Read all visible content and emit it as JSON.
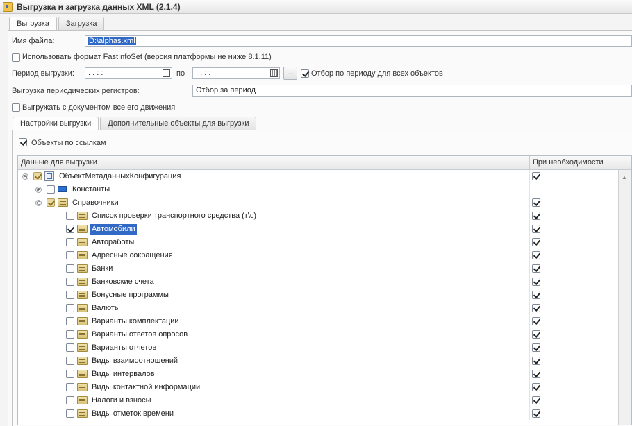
{
  "window": {
    "title": "Выгрузка и загрузка данных XML (2.1.4)"
  },
  "tabs": [
    {
      "label": "Выгрузка",
      "active": true
    },
    {
      "label": "Загрузка",
      "active": false
    }
  ],
  "form": {
    "file_label": "Имя файла:",
    "file_value": "D:\\alphas.xml",
    "fastinfoset_label": "Использовать формат FastInfoSet (версия платформы не ниже 8.1.11)",
    "fastinfoset_checked": false,
    "period_label": "Период выгрузки:",
    "period_from": " .  .     :  :",
    "period_to_label": "по",
    "period_to": " .  .     :  :",
    "period_button": "...",
    "filter_label": "Отбор по периоду для всех объектов",
    "filter_checked": true,
    "registers_label": "Выгрузка периодических регистров:",
    "registers_value": "Отбор за период",
    "movements_label": "Выгружать с документом все его движения",
    "movements_checked": false
  },
  "inner_tabs": [
    {
      "label": "Настройки выгрузки",
      "active": true
    },
    {
      "label": "Дополнительные объекты для выгрузки",
      "active": false
    }
  ],
  "refs_label": "Объекты по ссылкам",
  "grid": {
    "col_data": "Данные для выгрузки",
    "col_needed": "При необходимости",
    "rows": [
      {
        "label": "ОбъектМетаданныхКонфигурация",
        "level": 0,
        "expander": "⊖",
        "icon": "metadata-icon",
        "check": "partial",
        "needed": true
      },
      {
        "label": "Константы",
        "level": 1,
        "expander": "⊕",
        "icon": "constant-icon",
        "check": "off",
        "needed": false
      },
      {
        "label": "Справочники",
        "level": 1,
        "expander": "⊖",
        "icon": "folder-icon",
        "check": "partial",
        "needed": true
      },
      {
        "label": "Список проверки транспортного средства (т\\с)",
        "level": 2,
        "icon": "folder-icon",
        "check": "off",
        "needed": true
      },
      {
        "label": "Автомобили",
        "level": 2,
        "icon": "folder-icon",
        "check": "on",
        "needed": true,
        "selected": true
      },
      {
        "label": "Автоработы",
        "level": 2,
        "icon": "folder-icon",
        "check": "off",
        "needed": true
      },
      {
        "label": "Адресные сокращения",
        "level": 2,
        "icon": "folder-icon",
        "check": "off",
        "needed": true
      },
      {
        "label": "Банки",
        "level": 2,
        "icon": "folder-icon",
        "check": "off",
        "needed": true
      },
      {
        "label": "Банковские счета",
        "level": 2,
        "icon": "folder-icon",
        "check": "off",
        "needed": true
      },
      {
        "label": "Бонусные программы",
        "level": 2,
        "icon": "folder-icon",
        "check": "off",
        "needed": true
      },
      {
        "label": "Валюты",
        "level": 2,
        "icon": "folder-icon",
        "check": "off",
        "needed": true
      },
      {
        "label": "Варианты комплектации",
        "level": 2,
        "icon": "folder-icon",
        "check": "off",
        "needed": true
      },
      {
        "label": "Варианты ответов опросов",
        "level": 2,
        "icon": "folder-icon",
        "check": "off",
        "needed": true
      },
      {
        "label": "Варианты отчетов",
        "level": 2,
        "icon": "folder-icon",
        "check": "off",
        "needed": true
      },
      {
        "label": "Виды взаимоотношений",
        "level": 2,
        "icon": "folder-icon",
        "check": "off",
        "needed": true
      },
      {
        "label": "Виды интервалов",
        "level": 2,
        "icon": "folder-icon",
        "check": "off",
        "needed": true
      },
      {
        "label": "Виды контактной информации",
        "level": 2,
        "icon": "folder-icon",
        "check": "off",
        "needed": true
      },
      {
        "label": "Налоги и взносы",
        "level": 2,
        "icon": "folder-icon",
        "check": "off",
        "needed": true
      },
      {
        "label": "Виды отметок времени",
        "level": 2,
        "icon": "folder-icon",
        "check": "off",
        "needed": true
      }
    ]
  }
}
